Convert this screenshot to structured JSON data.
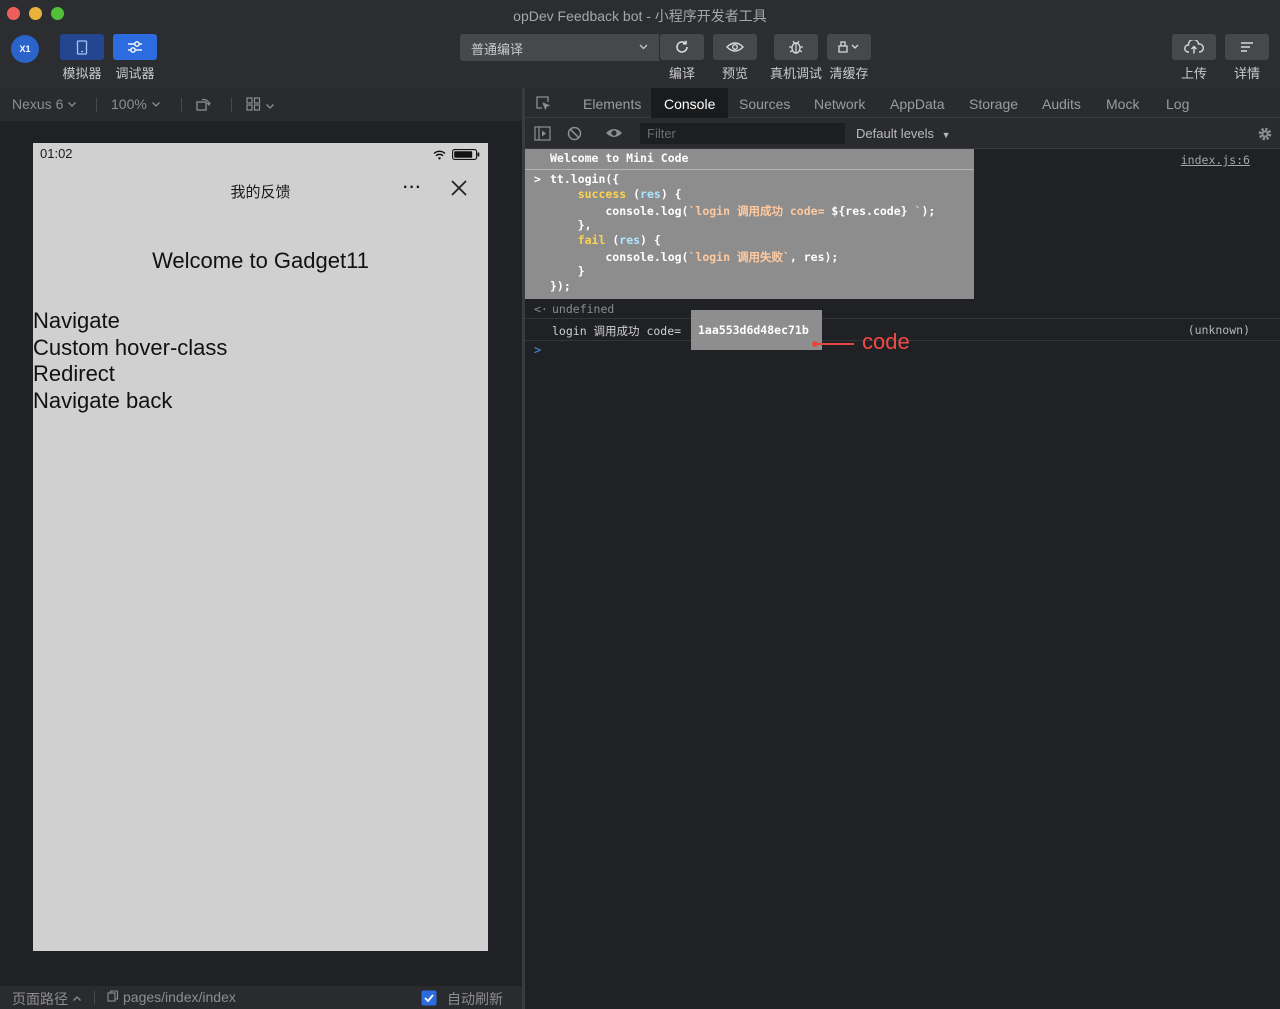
{
  "window": {
    "title": "opDev Feedback bot - 小程序开发者工具"
  },
  "toolbar": {
    "avatar_text": "X1",
    "simulator_label": "模拟器",
    "debugger_label": "调试器",
    "compile_mode": "普通编译",
    "compile_label": "编译",
    "preview_label": "预览",
    "device_debug_label": "真机调试",
    "clear_cache_label": "清缓存",
    "upload_label": "上传",
    "details_label": "详情"
  },
  "simulator": {
    "device": "Nexus 6",
    "zoom": "100%",
    "phone": {
      "time": "01:02",
      "nav_title": "我的反馈",
      "more_label": "···",
      "welcome": "Welcome to Gadget11",
      "links": [
        "Navigate",
        "Custom hover-class",
        "Redirect",
        "Navigate back"
      ]
    },
    "footer": {
      "page_path_label": "页面路径",
      "path": "pages/index/index",
      "auto_refresh_label": "自动刷新",
      "auto_refresh_checked": true
    }
  },
  "devtools": {
    "tabs": [
      "Elements",
      "Console",
      "Sources",
      "Network",
      "AppData",
      "Storage",
      "Audits",
      "Mock",
      "Log"
    ],
    "active_tab": "Console",
    "filter_placeholder": "Filter",
    "levels": "Default levels",
    "console": {
      "welcome": "Welcome to Mini Code",
      "welcome_source": "index.js:6",
      "undefined_text": "undefined",
      "log_text": "login 调用成功 code=",
      "code_value": "1aa553d6d48ec71b",
      "log_source": "(unknown)"
    }
  },
  "annotation": {
    "label": "code",
    "color": "#ef4b46"
  }
}
